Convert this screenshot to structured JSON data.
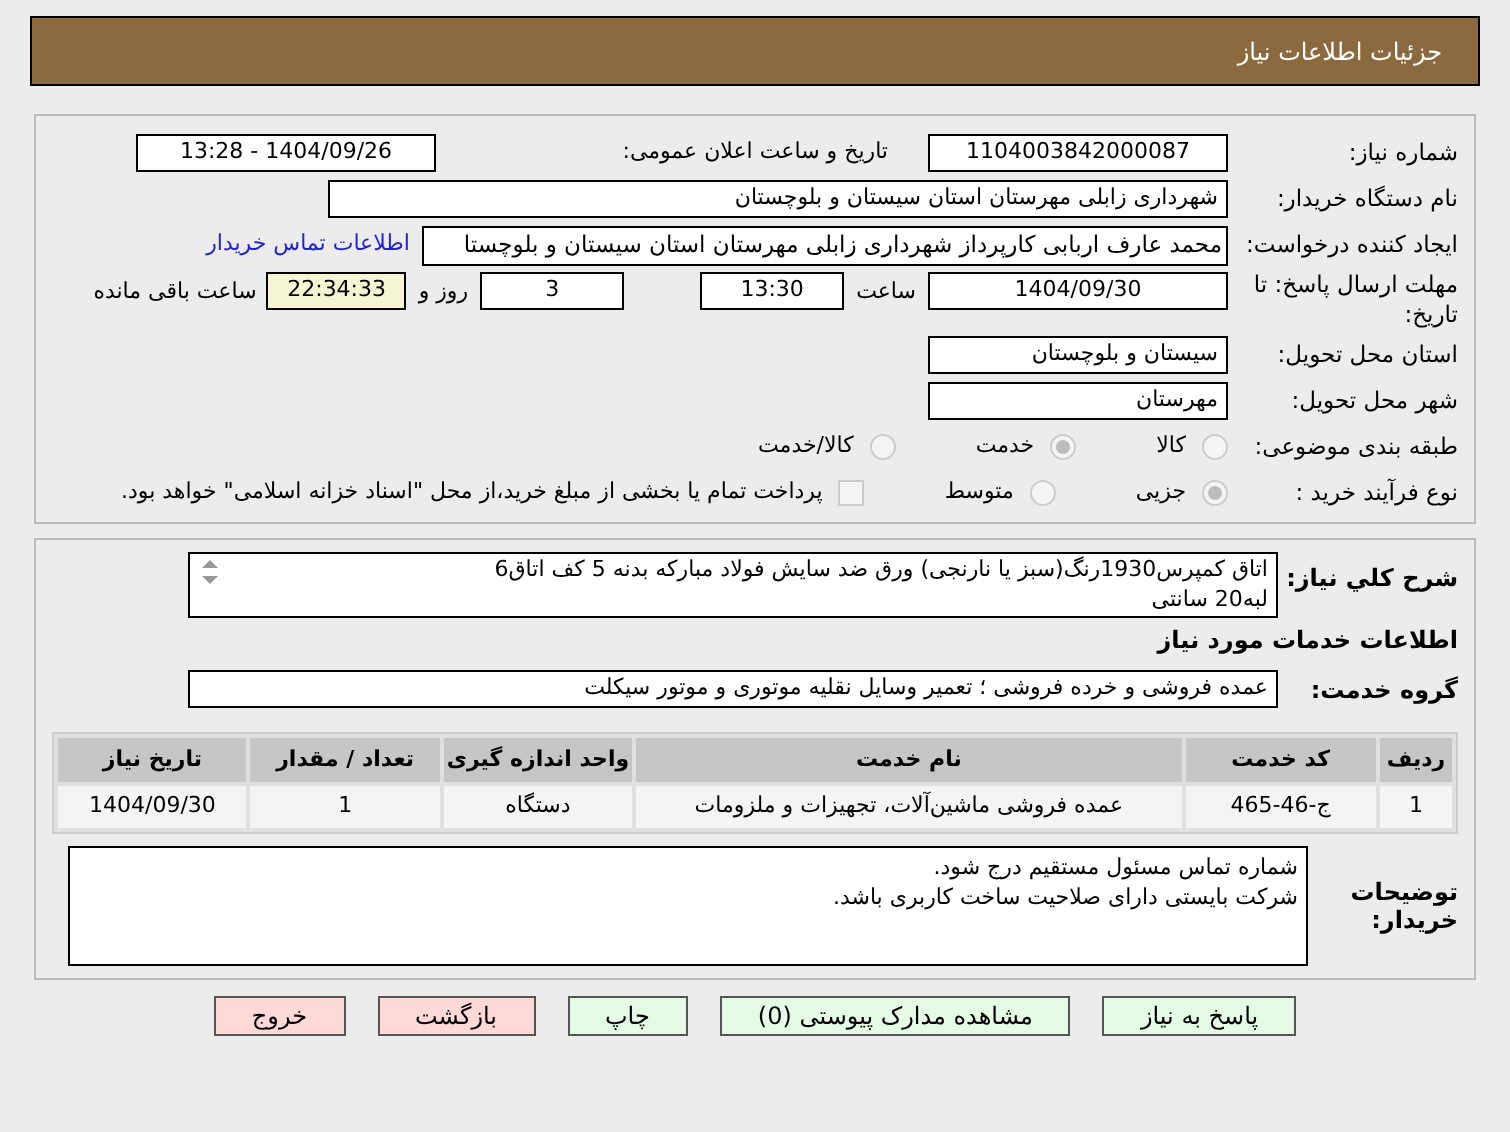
{
  "header": {
    "title": "جزئیات اطلاعات نیاز"
  },
  "fields": {
    "need_number": {
      "label": "شماره نیاز:",
      "value": "1104003842000087"
    },
    "announce": {
      "label": "تاریخ و ساعت اعلان عمومی:",
      "value": "1404/09/26 - 13:28"
    },
    "buyer": {
      "label": "نام دستگاه خریدار:",
      "value": "شهرداری زابلی مهرستان استان سیستان و بلوچستان"
    },
    "creator": {
      "label": "ایجاد کننده درخواست:",
      "value": "محمد عارف اربابی کارپرداز شهرداری زابلی مهرستان استان سیستان و بلوچستا",
      "link": "اطلاعات تماس خریدار"
    },
    "deadline": {
      "label": "مهلت ارسال پاسخ: تا تاریخ:",
      "date": "1404/09/30",
      "time_label": "ساعت",
      "time": "13:30",
      "days": "3",
      "days_label": "روز و",
      "remaining": "22:34:33",
      "remaining_label": "ساعت باقی مانده"
    },
    "province": {
      "label": "استان محل تحویل:",
      "value": "سیستان و بلوچستان"
    },
    "city": {
      "label": "شهر محل تحویل:",
      "value": "مهرستان"
    }
  },
  "category": {
    "label": "طبقه بندی موضوعی:",
    "options": [
      {
        "label": "کالا",
        "selected": false
      },
      {
        "label": "خدمت",
        "selected": true
      },
      {
        "label": "کالا/خدمت",
        "selected": false
      }
    ]
  },
  "purchase_type": {
    "label": "نوع فرآیند خرید :",
    "options": [
      {
        "label": "جزیی",
        "selected": true
      },
      {
        "label": "متوسط",
        "selected": false
      }
    ],
    "payment": {
      "label": "پرداخت تمام یا بخشی از مبلغ خرید،از محل \"اسناد خزانه اسلامی\" خواهد بود.",
      "checked": false
    }
  },
  "description": {
    "label": "شرح کلي نياز:",
    "value": "اتاق کمپرس1930رنگ(سبز یا نارنجی) ورق ضد سایش فولاد مبارکه بدنه 5 کف اتاق6\nلبه20 سانتی"
  },
  "services_title": "اطلاعات خدمات مورد نیاز",
  "service_group": {
    "label": "گروه خدمت:",
    "value": "عمده فروشی و خرده فروشی ؛ تعمیر وسایل نقلیه موتوری و موتور سیکلت"
  },
  "table": {
    "columns": [
      "ردیف",
      "کد خدمت",
      "نام خدمت",
      "واحد اندازه گیری",
      "تعداد / مقدار",
      "تاریخ نیاز"
    ],
    "rows": [
      [
        "1",
        "ج-46-465",
        "عمده فروشی ماشین‌آلات، تجهیزات و ملزومات",
        "دستگاه",
        "1",
        "1404/09/30"
      ]
    ]
  },
  "notes": {
    "label": "توضیحات خریدار:",
    "value": "شماره تماس مسئول مستقیم درج شود.\nشرکت بایستی دارای صلاحیت ساخت کاربری باشد."
  },
  "buttons": [
    {
      "label": "پاسخ به نیاز",
      "kind": "normal"
    },
    {
      "label": "مشاهده مدارک پیوستی (0)",
      "kind": "normal"
    },
    {
      "label": "چاپ",
      "kind": "normal"
    },
    {
      "label": "بازگشت",
      "kind": "exit"
    },
    {
      "label": "خروج",
      "kind": "exit"
    }
  ]
}
